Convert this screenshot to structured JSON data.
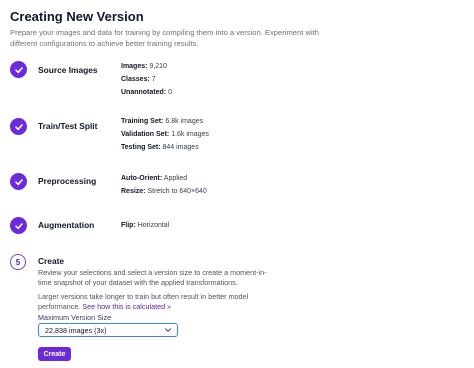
{
  "header": {
    "title": "Creating New Version",
    "description": "Prepare your images and data for training by compiling them into a version. Experiment with different configurations to achieve better training results."
  },
  "steps": [
    {
      "name": "Source Images",
      "status": "complete",
      "details": [
        {
          "key": "Images:",
          "value": "9,210"
        },
        {
          "key": "Classes:",
          "value": "7"
        },
        {
          "key": "Unannotated:",
          "value": "0"
        }
      ]
    },
    {
      "name": "Train/Test Split",
      "status": "complete",
      "details": [
        {
          "key": "Training Set:",
          "value": "6.8k images"
        },
        {
          "key": "Validation Set:",
          "value": "1.6k images"
        },
        {
          "key": "Testing Set:",
          "value": "844 images"
        }
      ]
    },
    {
      "name": "Preprocessing",
      "status": "complete",
      "details": [
        {
          "key": "Auto-Orient:",
          "value": "Applied"
        },
        {
          "key": "Resize:",
          "value": "Stretch to 640×640"
        }
      ]
    },
    {
      "name": "Augmentation",
      "status": "complete",
      "details": [
        {
          "key": "Flip:",
          "value": "Horizontal"
        }
      ]
    }
  ],
  "create_step": {
    "number": "5",
    "name": "Create",
    "text1": "Review your selections and select a version size to create a moment-in-time snapshot of your dataset with the applied transformations.",
    "text2": "Larger versions take longer to train but often result in better model performance.",
    "link": "See how this is calculated »",
    "size_label": "Maximum Version Size",
    "size_value": "22,838 images (3x)",
    "button_label": "Create"
  },
  "colors": {
    "accent": "#6c2bd9",
    "focus": "#3b82f6"
  },
  "icons": {
    "complete": "check-icon",
    "select": "chevron-down-icon"
  }
}
